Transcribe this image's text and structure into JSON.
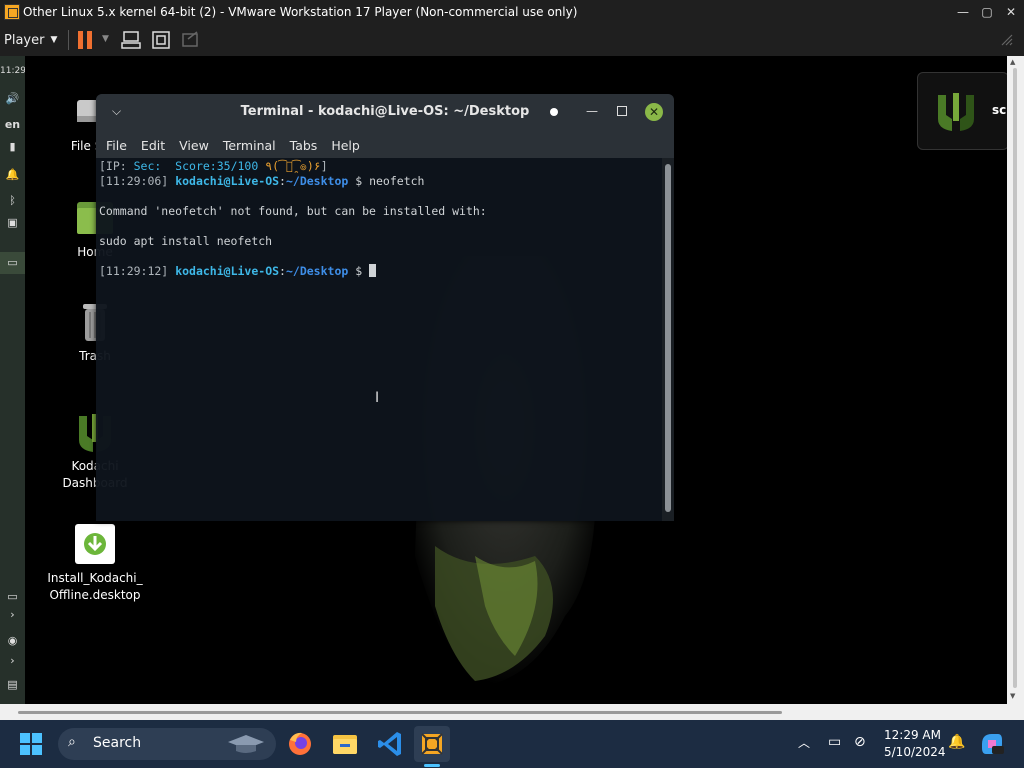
{
  "vm_window": {
    "title": "Other Linux 5.x kernel 64-bit (2) - VMware Workstation 17 Player (Non-commercial use only)",
    "minimize": "—",
    "maximize": "▢",
    "close": "✕"
  },
  "vm_toolbar": {
    "player_label": "Player",
    "pause_icon": "pause-icon",
    "accent": "#f07030"
  },
  "left_panel": {
    "clock": "11:29",
    "language": "en"
  },
  "desktop_icons": [
    {
      "label": "File Sy...",
      "icon": "file-system-icon"
    },
    {
      "label": "Home",
      "icon": "home-folder-icon"
    },
    {
      "label": "Trash",
      "icon": "trash-icon"
    },
    {
      "label": "Kodachi Dashboard",
      "icon": "kodachi-logo-icon"
    },
    {
      "label": "Install_Kodachi_ Offline.desktop",
      "icon": "download-icon"
    }
  ],
  "kodachi_widget": {
    "label": "sc"
  },
  "terminal": {
    "title": "Terminal - kodachi@Live-OS: ~/Desktop",
    "menu": [
      "File",
      "Edit",
      "View",
      "Terminal",
      "Tabs",
      "Help"
    ],
    "line1": {
      "prefix": "[IP: ",
      "sec": "Sec:",
      "score": "  Score:35/100 ",
      "emoji": "٩(͡๏̯͡๏)۶",
      "suffix": "]"
    },
    "prompt1": {
      "time": "[11:29:06]",
      "user": "kodachi@Live-OS",
      "colon": ":",
      "path": "~/Desktop",
      "dollar": " $ ",
      "cmd": "neofetch"
    },
    "output1": "Command 'neofetch' not found, but can be installed with:",
    "output2": "sudo apt install neofetch",
    "prompt2": {
      "time": "[11:29:12]",
      "user": "kodachi@Live-OS",
      "colon": ":",
      "path": "~/Desktop",
      "dollar": " $ "
    },
    "colors": {
      "user": "#3eb8e8",
      "path": "#3e8ee8",
      "close_button": "#8ab848"
    }
  },
  "taskbar": {
    "search_placeholder": "Search",
    "clock_time": "12:29 AM",
    "clock_date": "5/10/2024",
    "apps": [
      "firefox-icon",
      "file-explorer-icon",
      "vscode-icon",
      "vmware-icon"
    ]
  }
}
